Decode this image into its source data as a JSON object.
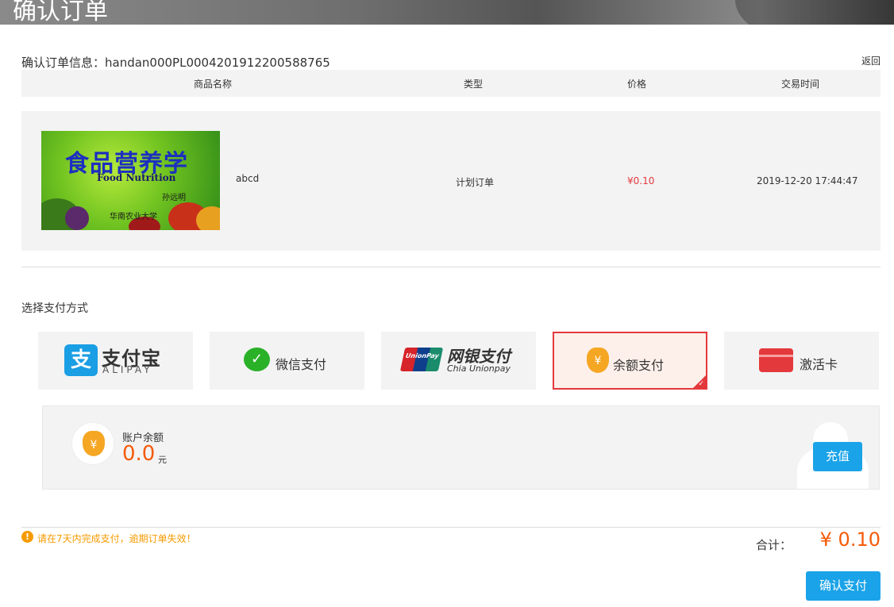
{
  "header": {
    "title": "确认订单"
  },
  "order": {
    "info_label": "确认订单信息：handan000PL0004201912200588765",
    "return_label": "返回"
  },
  "table": {
    "headers": [
      "商品名称",
      "类型",
      "价格",
      "交易时间"
    ],
    "item": {
      "cover": {
        "title": "食品营养学",
        "subtitle": "Food Nutrition",
        "author": "孙远明",
        "publisher": "华南农业大学"
      },
      "name": "abcd",
      "type": "计划订单",
      "price": "¥0.10",
      "time": "2019-12-20 17:44:47"
    }
  },
  "payment": {
    "title": "选择支付方式",
    "options": [
      {
        "id": "alipay",
        "label_cn": "支付宝",
        "label_en": "ALIPAY",
        "icon": "alipay-icon"
      },
      {
        "id": "wechat",
        "label": "微信支付",
        "icon": "wechat-icon"
      },
      {
        "id": "unionpay",
        "label_cn": "网银支付",
        "label_en": "Chia Unionpay",
        "icon": "unionpay-icon",
        "icon_text": "UnionPay"
      },
      {
        "id": "balance",
        "label": "余额支付",
        "icon": "money-bag-icon",
        "selected": true
      },
      {
        "id": "card",
        "label": "激活卡",
        "icon": "card-icon"
      }
    ],
    "selected_color": "#e4393c"
  },
  "balance": {
    "label": "账户余额",
    "amount": "0.0",
    "unit": "元",
    "recharge_label": "充值"
  },
  "footer": {
    "warning": "请在7天内完成支付，逾期订单失效！",
    "total_label": "合计：",
    "total_amount": "¥ 0.10",
    "confirm_label": "确认支付"
  },
  "colors": {
    "accent": "#1aa3e8",
    "price": "#e4393c",
    "amount": "#f55b0a",
    "warning": "#f59b00"
  }
}
